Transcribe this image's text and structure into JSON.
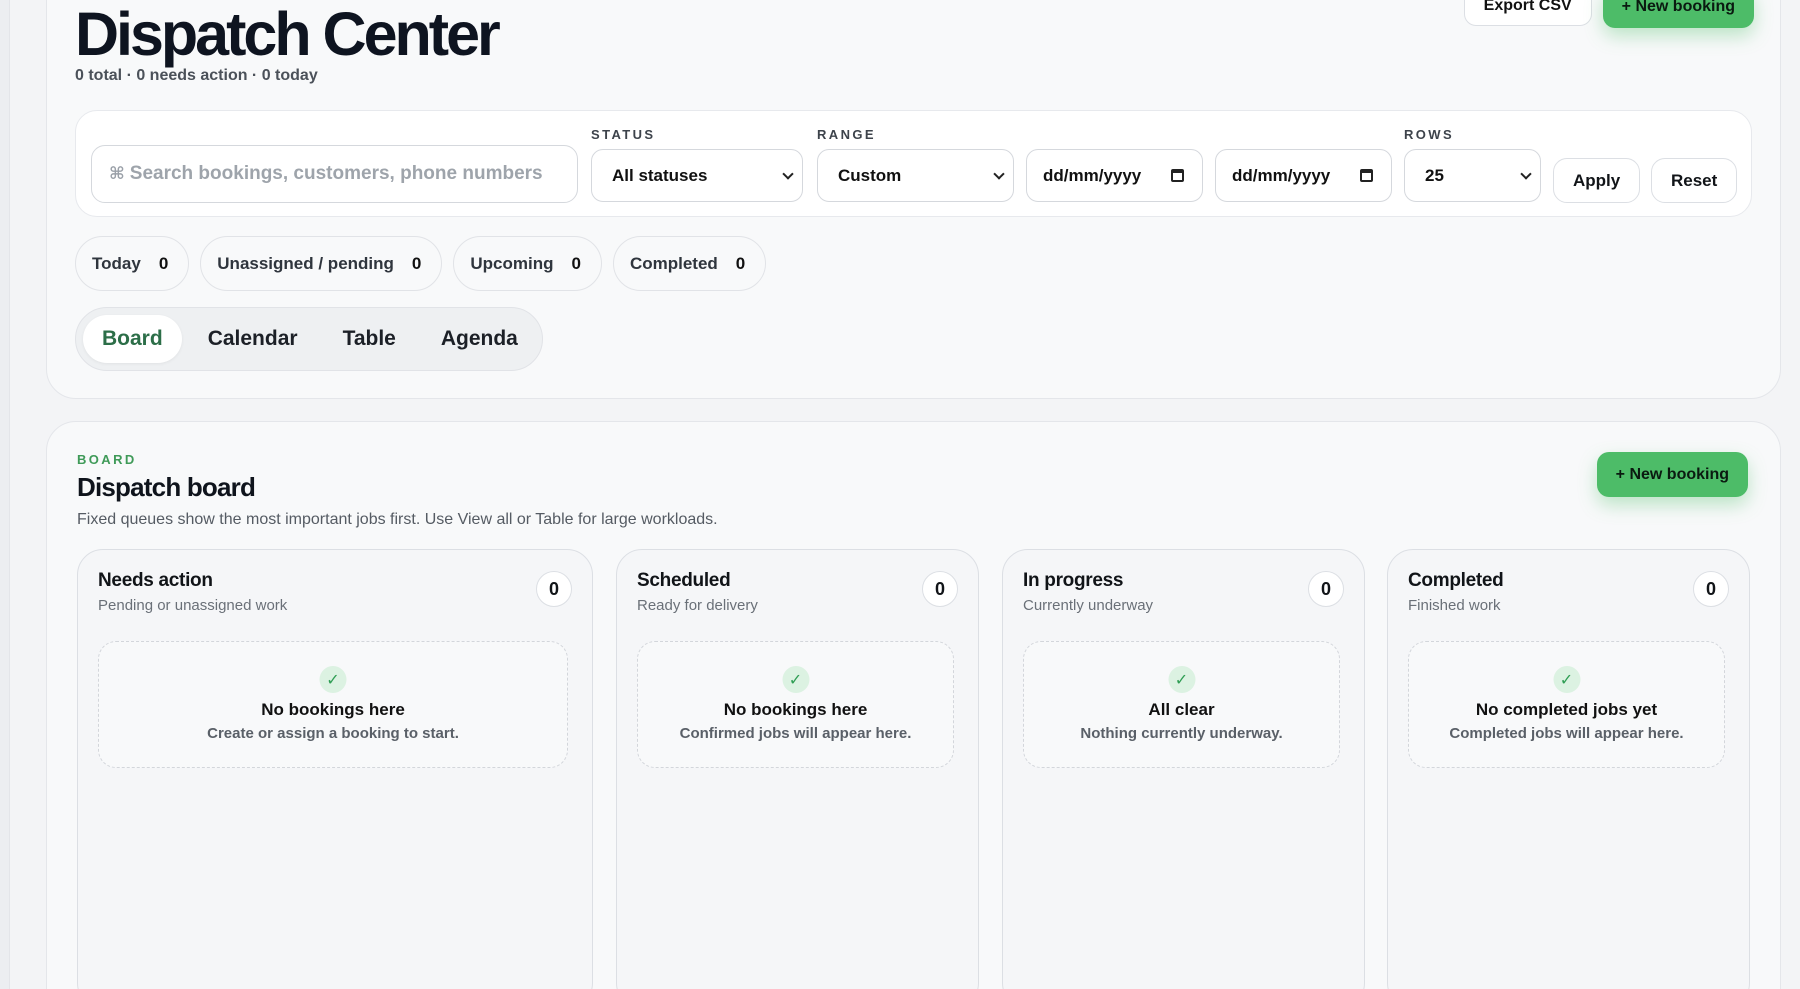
{
  "header": {
    "title": "Dispatch Center",
    "summary": "0 total · 0 needs action · 0 today",
    "export_label": "Export CSV",
    "new_booking_label": "+ New booking"
  },
  "filters": {
    "search_placeholder": "Search bookings, customers, phone numbers",
    "status_label": "STATUS",
    "status_value": "All statuses",
    "range_label": "RANGE",
    "range_value": "Custom",
    "date_from": "dd/mm/yyyy",
    "date_to": "dd/mm/yyyy",
    "rows_label": "ROWS",
    "rows_value": "25",
    "apply_label": "Apply",
    "reset_label": "Reset"
  },
  "chips": [
    {
      "label": "Today",
      "count": "0"
    },
    {
      "label": "Unassigned / pending",
      "count": "0"
    },
    {
      "label": "Upcoming",
      "count": "0"
    },
    {
      "label": "Completed",
      "count": "0"
    }
  ],
  "view_tabs": [
    {
      "label": "Board",
      "active": true
    },
    {
      "label": "Calendar",
      "active": false
    },
    {
      "label": "Table",
      "active": false
    },
    {
      "label": "Agenda",
      "active": false
    }
  ],
  "board": {
    "eyebrow": "BOARD",
    "title": "Dispatch board",
    "description": "Fixed queues show the most important jobs first. Use View all or Table for large workloads.",
    "new_booking_label": "+ New booking",
    "columns": [
      {
        "title": "Needs action",
        "subtitle": "Pending or unassigned work",
        "count": "0",
        "empty_title": "No bookings here",
        "empty_sub": "Create or assign a booking to start."
      },
      {
        "title": "Scheduled",
        "subtitle": "Ready for delivery",
        "count": "0",
        "empty_title": "No bookings here",
        "empty_sub": "Confirmed jobs will appear here."
      },
      {
        "title": "In progress",
        "subtitle": "Currently underway",
        "count": "0",
        "empty_title": "All clear",
        "empty_sub": "Nothing currently underway."
      },
      {
        "title": "Completed",
        "subtitle": "Finished work",
        "count": "0",
        "empty_title": "No completed jobs yet",
        "empty_sub": "Completed jobs will appear here."
      }
    ]
  },
  "colors": {
    "accent_green": "#4dbc68",
    "active_tab_text": "#2c6e48",
    "eyebrow_green": "#3f9a58"
  }
}
